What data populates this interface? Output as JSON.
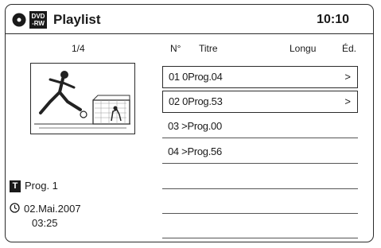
{
  "header": {
    "disc_badge_line1": "DVD",
    "disc_badge_line2": "-RW",
    "title": "Playlist",
    "clock": "10:10"
  },
  "preview": {
    "counter": "1/4"
  },
  "info": {
    "program_icon": "T",
    "program": "Prog. 1",
    "date": "02.Mai.2007",
    "time": "03:25"
  },
  "columns": {
    "number": "N°",
    "title": "Titre",
    "length": "Longu",
    "edit": "Éd."
  },
  "rows": [
    {
      "text": "01 0Prog.04",
      "arrow": ">"
    },
    {
      "text": "02 0Prog.53",
      "arrow": ">"
    },
    {
      "text": "03 >Prog.00"
    },
    {
      "text": "04 >Prog.56"
    }
  ]
}
